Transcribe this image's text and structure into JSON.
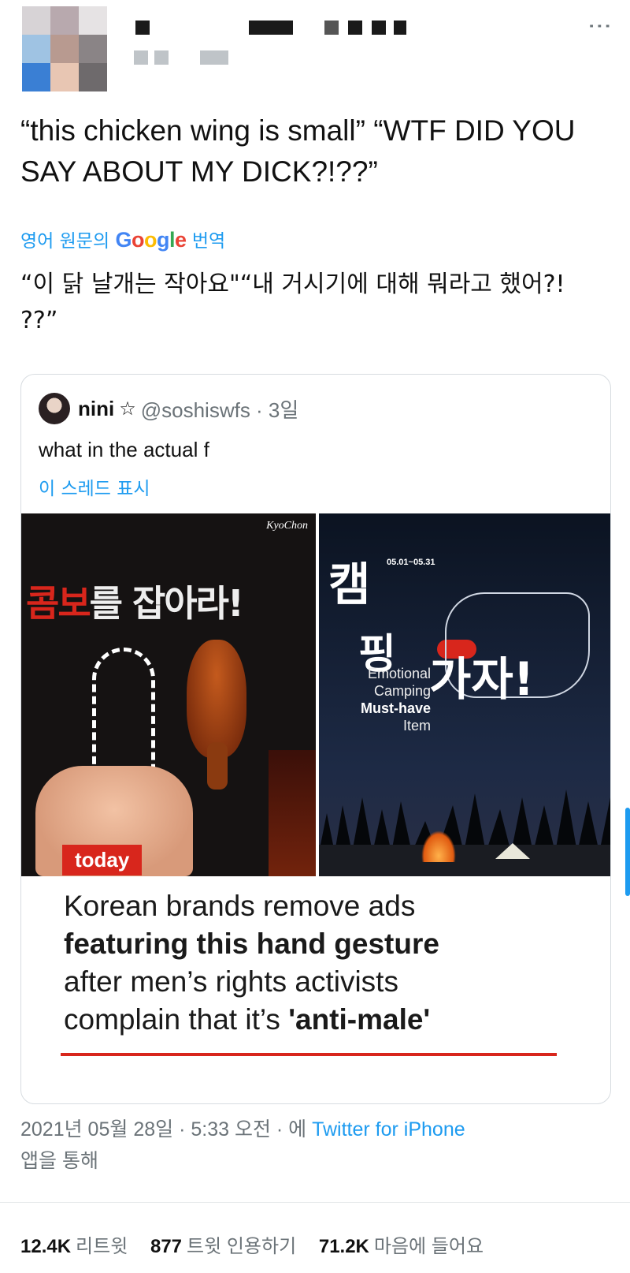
{
  "tweet": {
    "text": "“this chicken wing is small” “WTF DID YOU SAY ABOUT MY DICK?!??”",
    "translate_prefix": "영어 원문의",
    "translate_suffix": "번역",
    "translated_text": "“이 닭 날개는 작아요\"“내 거시기에 대해 뭐라고 했어?! ??”",
    "more_icon": "⋮"
  },
  "quoted": {
    "name": "nini",
    "star": "☆",
    "handle_time": "@soshiswfs · 3일",
    "text": "what in the actual f",
    "show_thread": "이 스레드 표시",
    "media": {
      "left": {
        "brand": "KyoChon",
        "title_red": "콤보",
        "title_rest": "를 잡아라!",
        "badge": "today"
      },
      "right": {
        "dates": "05.01~05.31",
        "title1": "캠",
        "title2": "핑",
        "title3": "가자!",
        "emotional": "Emotional",
        "camping": "Camping",
        "must_have": "Must-have",
        "item": "Item"
      }
    },
    "headline": {
      "line1": "Korean brands remove ads",
      "line2": "featuring this hand gesture",
      "line3": "after men’s rights activists",
      "line4_prefix": "complain that it’s ",
      "line4_bold": "'anti-male'"
    }
  },
  "meta": {
    "datetime": "2021년 05월 28일 · 5:33 오전 · 에 ",
    "source": "Twitter for iPhone",
    "via": "앱을 통해"
  },
  "stats": {
    "retweets_count": "12.4K",
    "retweets_label": "리트윗",
    "quotes_count": "877",
    "quotes_label": "트윗 인용하기",
    "likes_count": "71.2K",
    "likes_label": "마음에 들어요"
  },
  "colors": {
    "accent": "#1d9bf0",
    "text": "#0f1419",
    "muted": "#6b7378",
    "brand_red": "#d8261c"
  }
}
